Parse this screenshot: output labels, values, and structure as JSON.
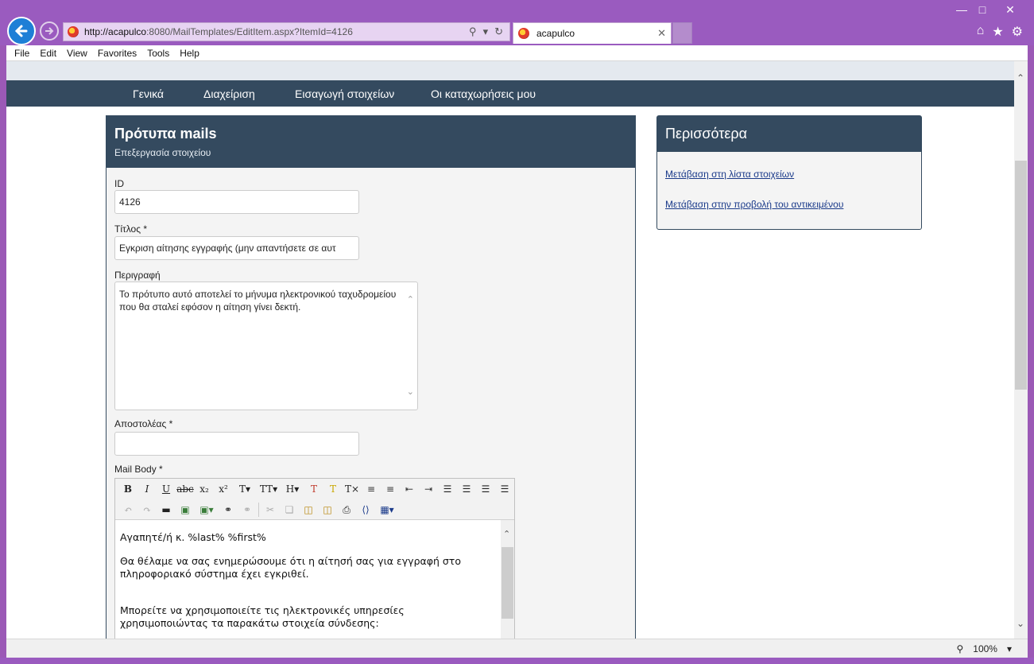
{
  "browser": {
    "url_host": "http://acapulco",
    "url_rest": ":8080/MailTemplates/EditItem.aspx?ItemId=4126",
    "tab_title": "acapulco",
    "menu": [
      "File",
      "Edit",
      "View",
      "Favorites",
      "Tools",
      "Help"
    ],
    "zoom": "100%"
  },
  "nav": {
    "items": [
      "Γενικά",
      "Διαχείριση",
      "Εισαγωγή στοιχείων",
      "Οι καταχωρήσεις μου"
    ]
  },
  "panel": {
    "title": "Πρότυπα mails",
    "subtitle": "Επεξεργασία στοιχείου",
    "id_label": "ID",
    "id_value": "4126",
    "title_label": "Τίτλος *",
    "title_value": "Εγκριση αίτησης εγγραφής (μην απαντήσετε σε αυτ",
    "desc_label": "Περιγραφή",
    "desc_value": "Το πρότυπο αυτό αποτελεί το μήνυμα ηλεκτρονικού ταχυδρομείου που θα σταλεί εφόσον η αίτηση γίνει δεκτή.",
    "sender_label": "Αποστολέας *",
    "sender_value": "",
    "body_label": "Mail Body *"
  },
  "editor": {
    "line1": "Αγαπητέ/ή κ. %last% %first%",
    "line2": "Θα θέλαμε να σας ενημερώσουμε ότι η αίτησή σας για εγγραφή στο πληροφοριακό σύστημα έχει εγκριθεί.",
    "line3": "Μπορείτε να χρησιμοποιείτε τις ηλεκτρονικές υπηρεσίες χρησιμοποιώντας τα παρακάτω στοιχεία σύνδεσης:"
  },
  "side": {
    "title": "Περισσότερα",
    "link1": "Μετάβαση στη λίστα στοιχείων",
    "link2": "Μετάβαση στην προβολή του αντικειμένου"
  }
}
